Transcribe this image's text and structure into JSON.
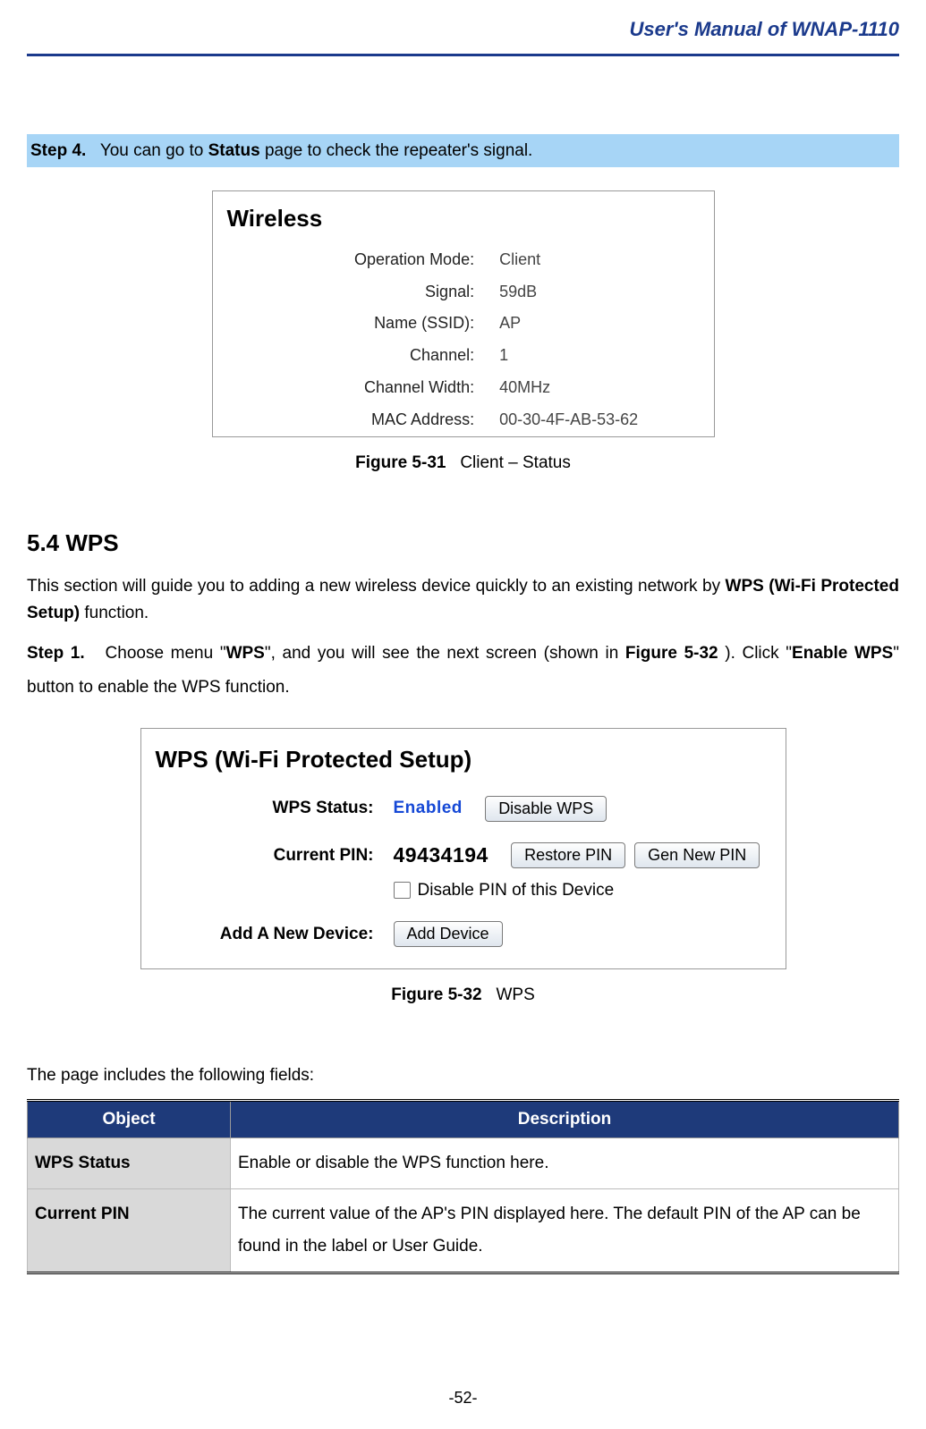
{
  "header": {
    "title": "User's Manual of WNAP-1110"
  },
  "step4": {
    "label": "Step 4.",
    "text_before": "You can go to ",
    "bold": "Status",
    "text_after": " page to check the repeater's signal."
  },
  "wireless": {
    "title": "Wireless",
    "rows": [
      {
        "label": "Operation Mode:",
        "value": "Client"
      },
      {
        "label": "Signal:",
        "value": "59dB"
      },
      {
        "label": "Name (SSID):",
        "value": "AP"
      },
      {
        "label": "Channel:",
        "value": "1"
      },
      {
        "label": "Channel Width:",
        "value": "40MHz"
      },
      {
        "label": "MAC Address:",
        "value": "00-30-4F-AB-53-62"
      }
    ]
  },
  "fig31": {
    "label": "Figure 5-31",
    "caption": "Client – Status"
  },
  "section54": {
    "heading": "5.4   WPS"
  },
  "intro": {
    "before": "This section will guide you to adding a new wireless device quickly to an existing network by ",
    "bold": "WPS (Wi-Fi Protected Setup)",
    "after": " function."
  },
  "step1": {
    "label": "Step 1.",
    "t1": "Choose menu \"",
    "b1": "WPS",
    "t2": "\", and you will see the next screen (shown in ",
    "b2": "Figure 5-32",
    "t3": " ). Click \"",
    "b3": "Enable WPS",
    "t4": "\" button to enable the WPS function."
  },
  "wps": {
    "title": "WPS (Wi-Fi Protected Setup)",
    "status_label": "WPS Status:",
    "status_value": "Enabled",
    "disable_btn": "Disable WPS",
    "pin_label": "Current PIN:",
    "pin_value": "49434194",
    "restore_btn": "Restore PIN",
    "gen_btn": "Gen New PIN",
    "disable_pin_label": "Disable PIN of this Device",
    "add_label": "Add A New Device:",
    "add_btn": "Add Device"
  },
  "fig32": {
    "label": "Figure 5-32",
    "caption": "WPS"
  },
  "fields_intro": "The page includes the following fields:",
  "table": {
    "headers": {
      "object": "Object",
      "description": "Description"
    },
    "rows": [
      {
        "object": "WPS Status",
        "description": "Enable or disable the WPS function here."
      },
      {
        "object": "Current PIN",
        "description": "The current value of the AP's PIN displayed here. The default PIN of the AP can be found in the label or User Guide."
      }
    ]
  },
  "footer": {
    "page": "-52-"
  }
}
